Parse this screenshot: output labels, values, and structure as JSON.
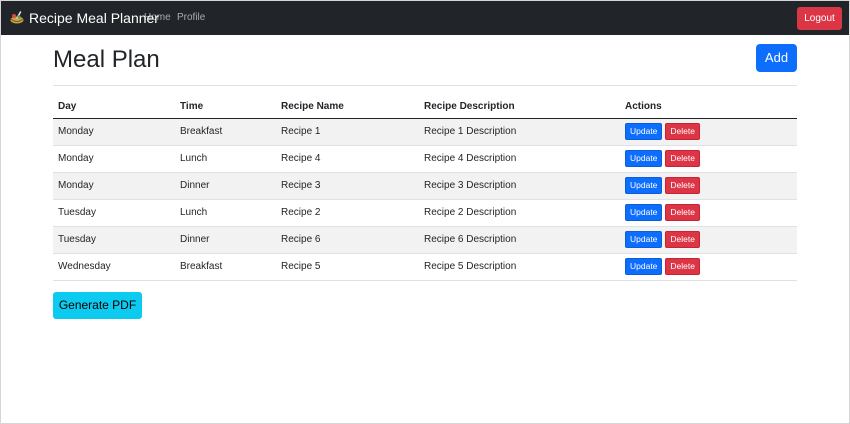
{
  "navbar": {
    "brand_label": "Recipe Meal Planner",
    "brand_icon": "recipe-icon",
    "links": [
      "Home",
      "Profile"
    ],
    "logout_label": "Logout"
  },
  "page": {
    "title": "Meal Plan",
    "add_label": "Add",
    "pdf_label": "Generate PDF"
  },
  "table": {
    "headers": [
      "Day",
      "Time",
      "Recipe Name",
      "Recipe Description",
      "Actions"
    ],
    "rows": [
      {
        "day": "Monday",
        "time": "Breakfast",
        "name": "Recipe 1",
        "description": "Recipe 1 Description"
      },
      {
        "day": "Monday",
        "time": "Lunch",
        "name": "Recipe 4",
        "description": "Recipe 4 Description"
      },
      {
        "day": "Monday",
        "time": "Dinner",
        "name": "Recipe 3",
        "description": "Recipe 3 Description"
      },
      {
        "day": "Tuesday",
        "time": "Lunch",
        "name": "Recipe 2",
        "description": "Recipe 2 Description"
      },
      {
        "day": "Tuesday",
        "time": "Dinner",
        "name": "Recipe 6",
        "description": "Recipe 6 Description"
      },
      {
        "day": "Wednesday",
        "time": "Breakfast",
        "name": "Recipe 5",
        "description": "Recipe 5 Description"
      }
    ],
    "update_label": "Update",
    "delete_label": "Delete"
  },
  "colors": {
    "navbar": "#212529",
    "primary": "#0d6efd",
    "danger": "#dc3545",
    "info": "#0dcaf0"
  }
}
